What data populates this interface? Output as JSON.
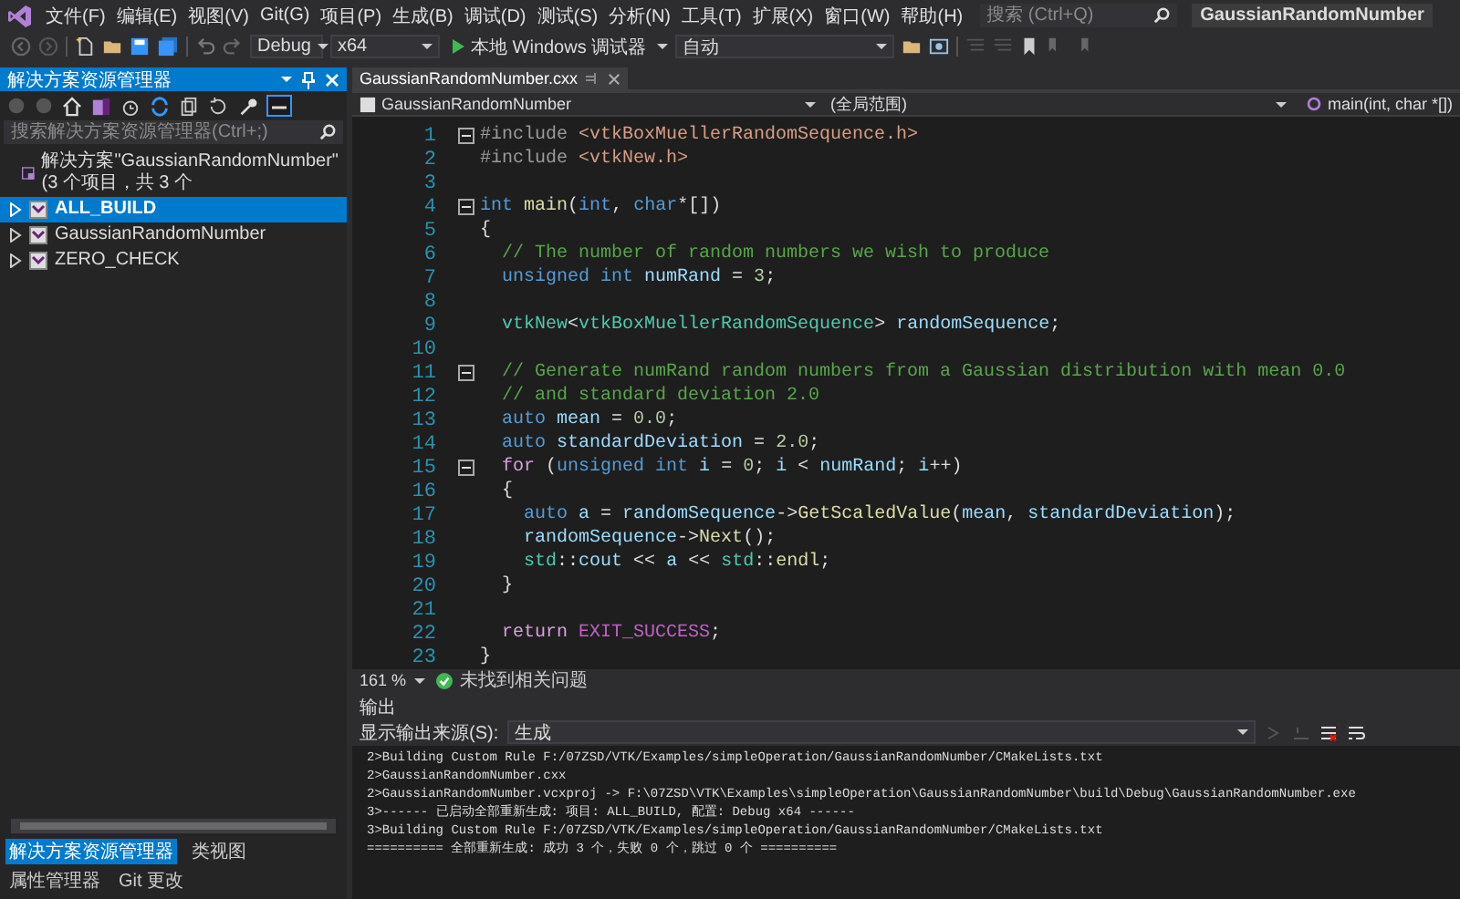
{
  "menu": [
    "文件(F)",
    "编辑(E)",
    "视图(V)",
    "Git(G)",
    "项目(P)",
    "生成(B)",
    "调试(D)",
    "测试(S)",
    "分析(N)",
    "工具(T)",
    "扩展(X)",
    "窗口(W)",
    "帮助(H)"
  ],
  "search": {
    "placeholder": "搜索 (Ctrl+Q)"
  },
  "window": {
    "title": "GaussianRandomNumber"
  },
  "toolbar": {
    "configuration": "Debug",
    "platform": "x64",
    "debugger": "本地 Windows 调试器",
    "mode": "自动"
  },
  "solution_explorer": {
    "title": "解决方案资源管理器",
    "search": {
      "placeholder": "搜索解决方案资源管理器(Ctrl+;)"
    },
    "tree": [
      {
        "label": "解决方案\"GaussianRandomNumber\"(3 个项目，共 3 个",
        "kind": "solution",
        "selected": false,
        "children": [
          {
            "label": "ALL_BUILD",
            "kind": "project",
            "selected": true,
            "expanded": false
          },
          {
            "label": "GaussianRandomNumber",
            "kind": "project",
            "selected": false,
            "expanded": false
          },
          {
            "label": "ZERO_CHECK",
            "kind": "project",
            "selected": false,
            "expanded": false
          }
        ]
      }
    ],
    "bottom_tabs": [
      {
        "label": "解决方案资源管理器",
        "selected": true
      },
      {
        "label": "类视图",
        "selected": false
      },
      {
        "label": "属性管理器",
        "selected": false
      },
      {
        "label": "Git 更改",
        "selected": false
      }
    ]
  },
  "editor": {
    "tabs": [
      {
        "label": "GaussianRandomNumber.cxx",
        "selected": true
      }
    ],
    "nav": {
      "project": "GaussianRandomNumber",
      "scope": "(全局范围)",
      "member": "main(int, char *[])"
    },
    "lines": [
      {
        "num": "1",
        "fold": true,
        "tokens": [
          {
            "kind": "pp",
            "text": "#include "
          },
          {
            "kind": "str",
            "text": "<vtkBoxMuellerRandomSequence.h>"
          }
        ]
      },
      {
        "num": "2",
        "fold": false,
        "tokens": [
          {
            "kind": "pp",
            "text": "#include "
          },
          {
            "kind": "str",
            "text": "<vtkNew.h>"
          }
        ]
      },
      {
        "num": "3",
        "fold": false
      },
      {
        "num": "4",
        "fold": true,
        "tokens": [
          {
            "kind": "kw",
            "text": "int "
          },
          {
            "kind": "fn",
            "text": "main"
          },
          {
            "kind": "plain",
            "text": "("
          },
          {
            "kind": "kw",
            "text": "int"
          },
          {
            "kind": "plain",
            "text": ", "
          },
          {
            "kind": "kw",
            "text": "char"
          },
          {
            "kind": "plain",
            "text": "*[])"
          }
        ]
      },
      {
        "num": "5",
        "fold": false,
        "tokens": [
          {
            "kind": "plain",
            "text": "{"
          }
        ]
      },
      {
        "num": "6",
        "fold": false,
        "tokens": [
          {
            "kind": "cm",
            "text": "  // The number of random numbers we wish to produce"
          }
        ]
      },
      {
        "num": "7",
        "fold": false,
        "tokens": [
          {
            "kind": "kw",
            "text": "  unsigned int "
          },
          {
            "kind": "var",
            "text": "numRand"
          },
          {
            "kind": "plain",
            "text": " = "
          },
          {
            "kind": "num",
            "text": "3"
          },
          {
            "kind": "plain",
            "text": ";"
          }
        ]
      },
      {
        "num": "8",
        "fold": false
      },
      {
        "num": "9",
        "fold": false,
        "tokens": [
          {
            "kind": "type",
            "text": "  vtkNew"
          },
          {
            "kind": "plain",
            "text": "<"
          },
          {
            "kind": "type",
            "text": "vtkBoxMuellerRandomSequence"
          },
          {
            "kind": "plain",
            "text": "> "
          },
          {
            "kind": "var",
            "text": "randomSequence"
          },
          {
            "kind": "plain",
            "text": ";"
          }
        ]
      },
      {
        "num": "10",
        "fold": false
      },
      {
        "num": "11",
        "fold": true,
        "tokens": [
          {
            "kind": "cm",
            "text": "  // Generate numRand random numbers from a Gaussian distribution with mean 0.0"
          }
        ]
      },
      {
        "num": "12",
        "fold": false,
        "tokens": [
          {
            "kind": "cm",
            "text": "  // and standard deviation 2.0"
          }
        ]
      },
      {
        "num": "13",
        "fold": false,
        "tokens": [
          {
            "kind": "kw",
            "text": "  auto "
          },
          {
            "kind": "var",
            "text": "mean"
          },
          {
            "kind": "plain",
            "text": " = "
          },
          {
            "kind": "num",
            "text": "0.0"
          },
          {
            "kind": "plain",
            "text": ";"
          }
        ]
      },
      {
        "num": "14",
        "fold": false,
        "tokens": [
          {
            "kind": "kw",
            "text": "  auto "
          },
          {
            "kind": "var",
            "text": "standardDeviation"
          },
          {
            "kind": "plain",
            "text": " = "
          },
          {
            "kind": "num",
            "text": "2.0"
          },
          {
            "kind": "plain",
            "text": ";"
          }
        ]
      },
      {
        "num": "15",
        "fold": true,
        "tokens": [
          {
            "kind": "ctl",
            "text": "  for"
          },
          {
            "kind": "plain",
            "text": " ("
          },
          {
            "kind": "kw",
            "text": "unsigned int "
          },
          {
            "kind": "var",
            "text": "i"
          },
          {
            "kind": "plain",
            "text": " = "
          },
          {
            "kind": "num",
            "text": "0"
          },
          {
            "kind": "plain",
            "text": "; "
          },
          {
            "kind": "var",
            "text": "i"
          },
          {
            "kind": "plain",
            "text": " < "
          },
          {
            "kind": "var",
            "text": "numRand"
          },
          {
            "kind": "plain",
            "text": "; "
          },
          {
            "kind": "var",
            "text": "i"
          },
          {
            "kind": "plain",
            "text": "++)"
          }
        ]
      },
      {
        "num": "16",
        "fold": false,
        "tokens": [
          {
            "kind": "plain",
            "text": "  {"
          }
        ]
      },
      {
        "num": "17",
        "fold": false,
        "tokens": [
          {
            "kind": "kw",
            "text": "    auto "
          },
          {
            "kind": "var",
            "text": "a"
          },
          {
            "kind": "plain",
            "text": " = "
          },
          {
            "kind": "var",
            "text": "randomSequence"
          },
          {
            "kind": "plain",
            "text": "->"
          },
          {
            "kind": "fn",
            "text": "GetScaledValue"
          },
          {
            "kind": "plain",
            "text": "("
          },
          {
            "kind": "var",
            "text": "mean"
          },
          {
            "kind": "plain",
            "text": ", "
          },
          {
            "kind": "var",
            "text": "standardDeviation"
          },
          {
            "kind": "plain",
            "text": ");"
          }
        ]
      },
      {
        "num": "18",
        "fold": false,
        "tokens": [
          {
            "kind": "var",
            "text": "    randomSequence"
          },
          {
            "kind": "plain",
            "text": "->"
          },
          {
            "kind": "fn",
            "text": "Next"
          },
          {
            "kind": "plain",
            "text": "();"
          }
        ]
      },
      {
        "num": "19",
        "fold": false,
        "tokens": [
          {
            "kind": "type",
            "text": "    std"
          },
          {
            "kind": "plain",
            "text": "::"
          },
          {
            "kind": "var",
            "text": "cout"
          },
          {
            "kind": "plain",
            "text": " << "
          },
          {
            "kind": "var",
            "text": "a"
          },
          {
            "kind": "plain",
            "text": " << "
          },
          {
            "kind": "type",
            "text": "std"
          },
          {
            "kind": "plain",
            "text": "::"
          },
          {
            "kind": "fn",
            "text": "endl"
          },
          {
            "kind": "plain",
            "text": ";"
          }
        ]
      },
      {
        "num": "20",
        "fold": false,
        "tokens": [
          {
            "kind": "plain",
            "text": "  }"
          }
        ]
      },
      {
        "num": "21",
        "fold": false
      },
      {
        "num": "22",
        "fold": false,
        "tokens": [
          {
            "kind": "ctl",
            "text": "  return "
          },
          {
            "kind": "macro",
            "text": "EXIT_SUCCESS"
          },
          {
            "kind": "plain",
            "text": ";"
          }
        ]
      },
      {
        "num": "23",
        "fold": false,
        "tokens": [
          {
            "kind": "plain",
            "text": "}"
          }
        ]
      }
    ],
    "status": {
      "zoom": "161 %",
      "issues": "未找到相关问题"
    }
  },
  "output": {
    "title": "输出",
    "source_label": "显示输出来源(S):",
    "source": "生成",
    "lines": [
      "2>Building Custom Rule F:/07ZSD/VTK/Examples/simpleOperation/GaussianRandomNumber/CMakeLists.txt",
      "2>GaussianRandomNumber.cxx",
      "2>GaussianRandomNumber.vcxproj -> F:\\07ZSD\\VTK\\Examples\\simpleOperation\\GaussianRandomNumber\\build\\Debug\\GaussianRandomNumber.exe",
      "3>------ 已启动全部重新生成: 项目: ALL_BUILD, 配置: Debug x64 ------",
      "3>Building Custom Rule F:/07ZSD/VTK/Examples/simpleOperation/GaussianRandomNumber/CMakeLists.txt",
      "========== 全部重新生成: 成功 3 个，失败 0 个，跳过 0 个 =========="
    ]
  }
}
